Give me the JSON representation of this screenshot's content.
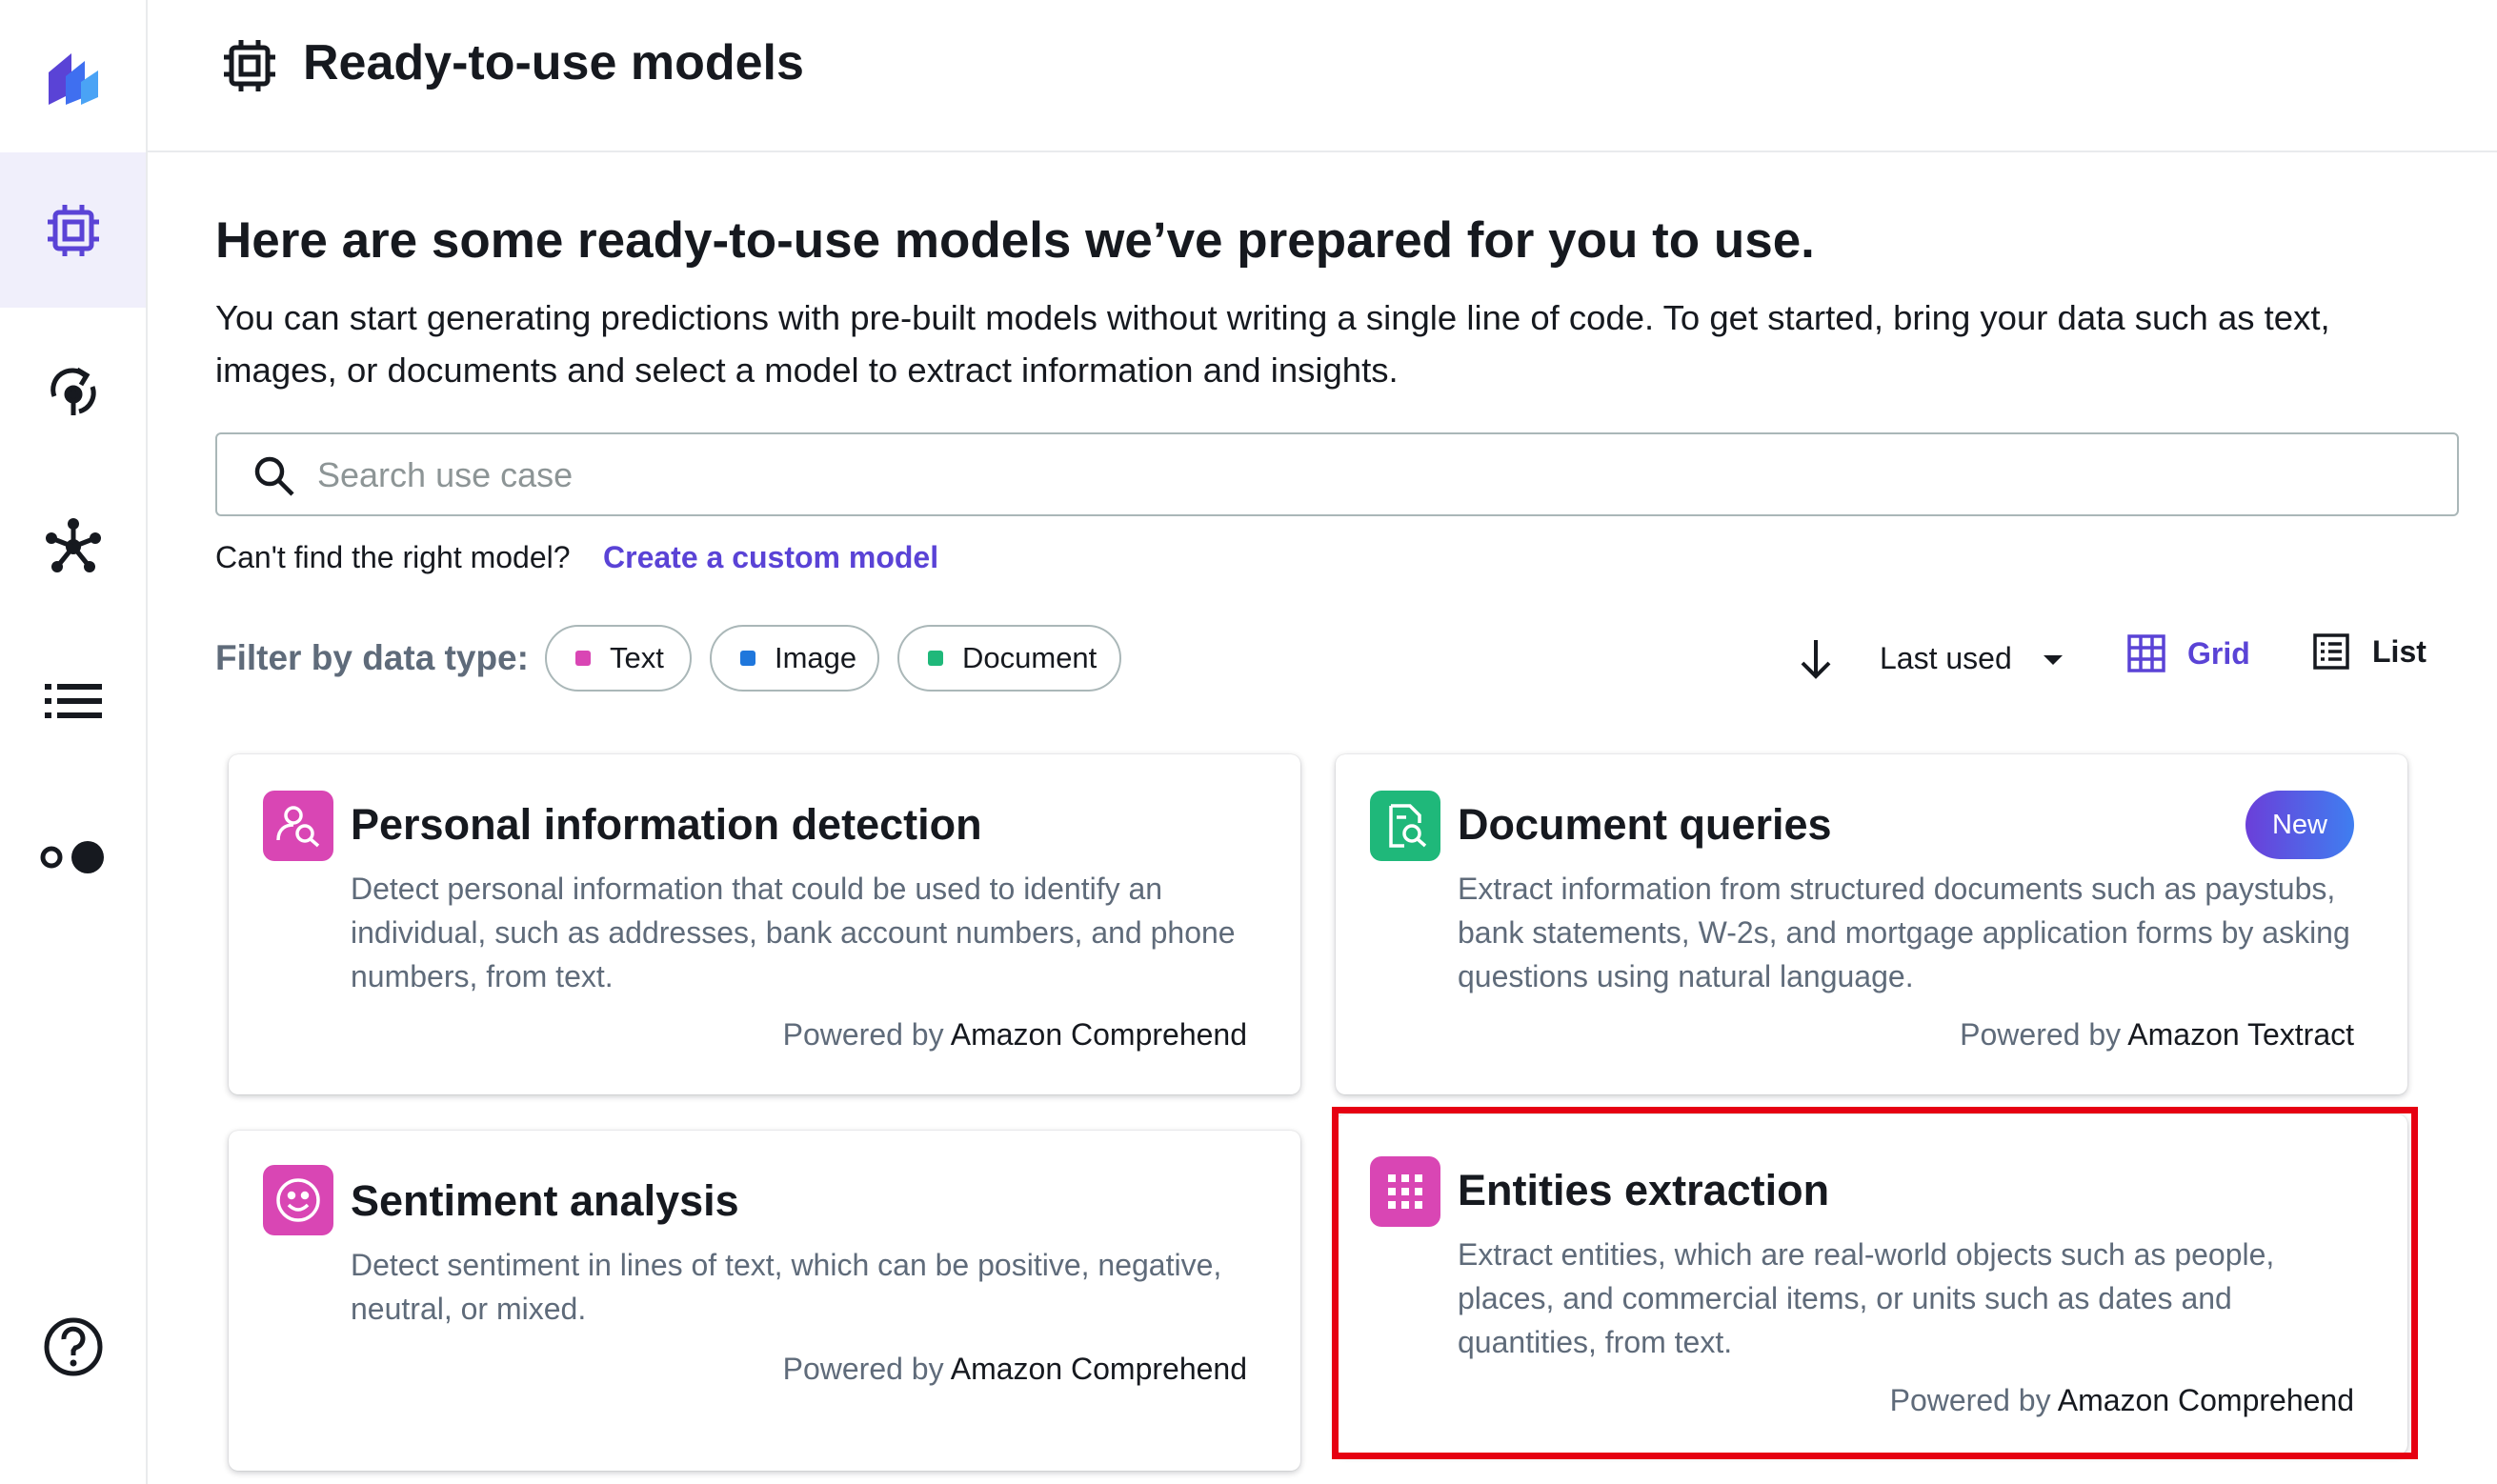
{
  "app": {
    "title": "Ready-to-use models",
    "accent_color": "#5a43d6"
  },
  "sidebar": {
    "items": [
      {
        "name": "app-logo",
        "icon": "canvas-logo-icon"
      },
      {
        "name": "ready-to-use-models",
        "icon": "chip-icon",
        "active": true
      },
      {
        "name": "models",
        "icon": "model-icon"
      },
      {
        "name": "datasets",
        "icon": "network-icon"
      },
      {
        "name": "list",
        "icon": "list-icon"
      },
      {
        "name": "toggle",
        "icon": "toggle-icon"
      },
      {
        "name": "help",
        "icon": "help-icon"
      }
    ]
  },
  "main": {
    "headline": "Here are some ready-to-use models we’ve prepared for you to use.",
    "description": "You can start generating predictions with pre-built models without writing a single line of code. To get started, bring your data such as text, images, or documents and select a model to extract information and insights.",
    "search": {
      "placeholder": "Search use case",
      "value": ""
    },
    "cant_find": "Can't find the right model?",
    "create_link": "Create a custom model",
    "filter_label": "Filter by data type:",
    "filters": [
      {
        "label": "Text",
        "color": "#d946b4"
      },
      {
        "label": "Image",
        "color": "#1f77dc"
      },
      {
        "label": "Document",
        "color": "#1fb87a"
      }
    ],
    "sort": {
      "label": "Last used"
    },
    "views": {
      "grid": "Grid",
      "list": "List",
      "selected": "Grid"
    }
  },
  "cards": [
    {
      "title": "Personal information detection",
      "description": "Detect personal information that could be used to identify an individual, such as addresses, bank account numbers, and phone numbers, from text.",
      "powered_prefix": "Powered by",
      "powered_service": "Amazon Comprehend",
      "icon": "person-search-icon",
      "icon_color": "#d946b4"
    },
    {
      "title": "Document queries",
      "description": "Extract information from structured documents such as paystubs, bank statements, W-2s, and mortgage application forms by asking questions using natural language.",
      "powered_prefix": "Powered by",
      "powered_service": "Amazon Textract",
      "icon": "document-search-icon",
      "icon_color": "#1fb87a",
      "badge": "New"
    },
    {
      "title": "Sentiment analysis",
      "description": "Detect sentiment in lines of text, which can be positive, negative, neutral, or mixed.",
      "powered_prefix": "Powered by",
      "powered_service": "Amazon Comprehend",
      "icon": "smiley-icon",
      "icon_color": "#d946b4"
    },
    {
      "title": "Entities extraction",
      "description": "Extract entities, which are real-world objects such as people, places, and commercial items, or units such as dates and quantities, from text.",
      "powered_prefix": "Powered by",
      "powered_service": "Amazon Comprehend",
      "icon": "grid-dots-icon",
      "icon_color": "#d946b4",
      "highlighted": true
    }
  ]
}
